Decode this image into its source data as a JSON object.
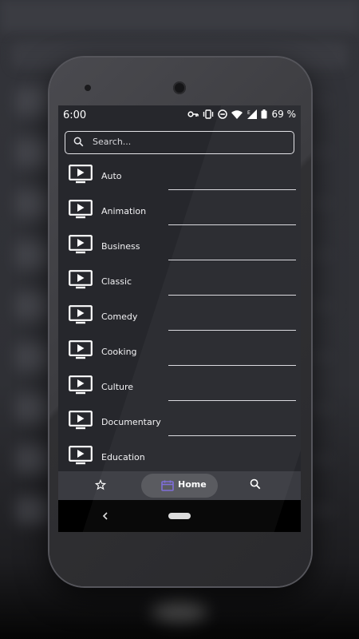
{
  "status": {
    "time": "6:00",
    "battery_percent": "69 %",
    "icons": [
      "vpn-key-icon",
      "vibrate-icon",
      "dnd-icon",
      "wifi-icon",
      "signal-e-icon",
      "battery-icon"
    ]
  },
  "search": {
    "placeholder": "Search..."
  },
  "categories": [
    {
      "label": "Auto",
      "icon": "tv-play-icon"
    },
    {
      "label": "Animation",
      "icon": "tv-play-icon"
    },
    {
      "label": "Business",
      "icon": "tv-play-icon"
    },
    {
      "label": "Classic",
      "icon": "tv-play-icon"
    },
    {
      "label": "Comedy",
      "icon": "tv-play-icon"
    },
    {
      "label": "Cooking",
      "icon": "tv-play-icon"
    },
    {
      "label": "Culture",
      "icon": "tv-play-icon"
    },
    {
      "label": "Documentary",
      "icon": "tv-play-icon"
    },
    {
      "label": "Education",
      "icon": "tv-play-icon"
    }
  ],
  "bottom_nav": {
    "favorites_icon": "star-icon",
    "home_label": "Home",
    "home_icon": "calendar-icon",
    "search_icon": "search-icon",
    "active": "Home"
  },
  "colors": {
    "screen_bg": "#26272c",
    "nav_bg": "#3a3b41",
    "active_pill": "#54555b",
    "home_icon_accent": "#7b6ad8"
  }
}
